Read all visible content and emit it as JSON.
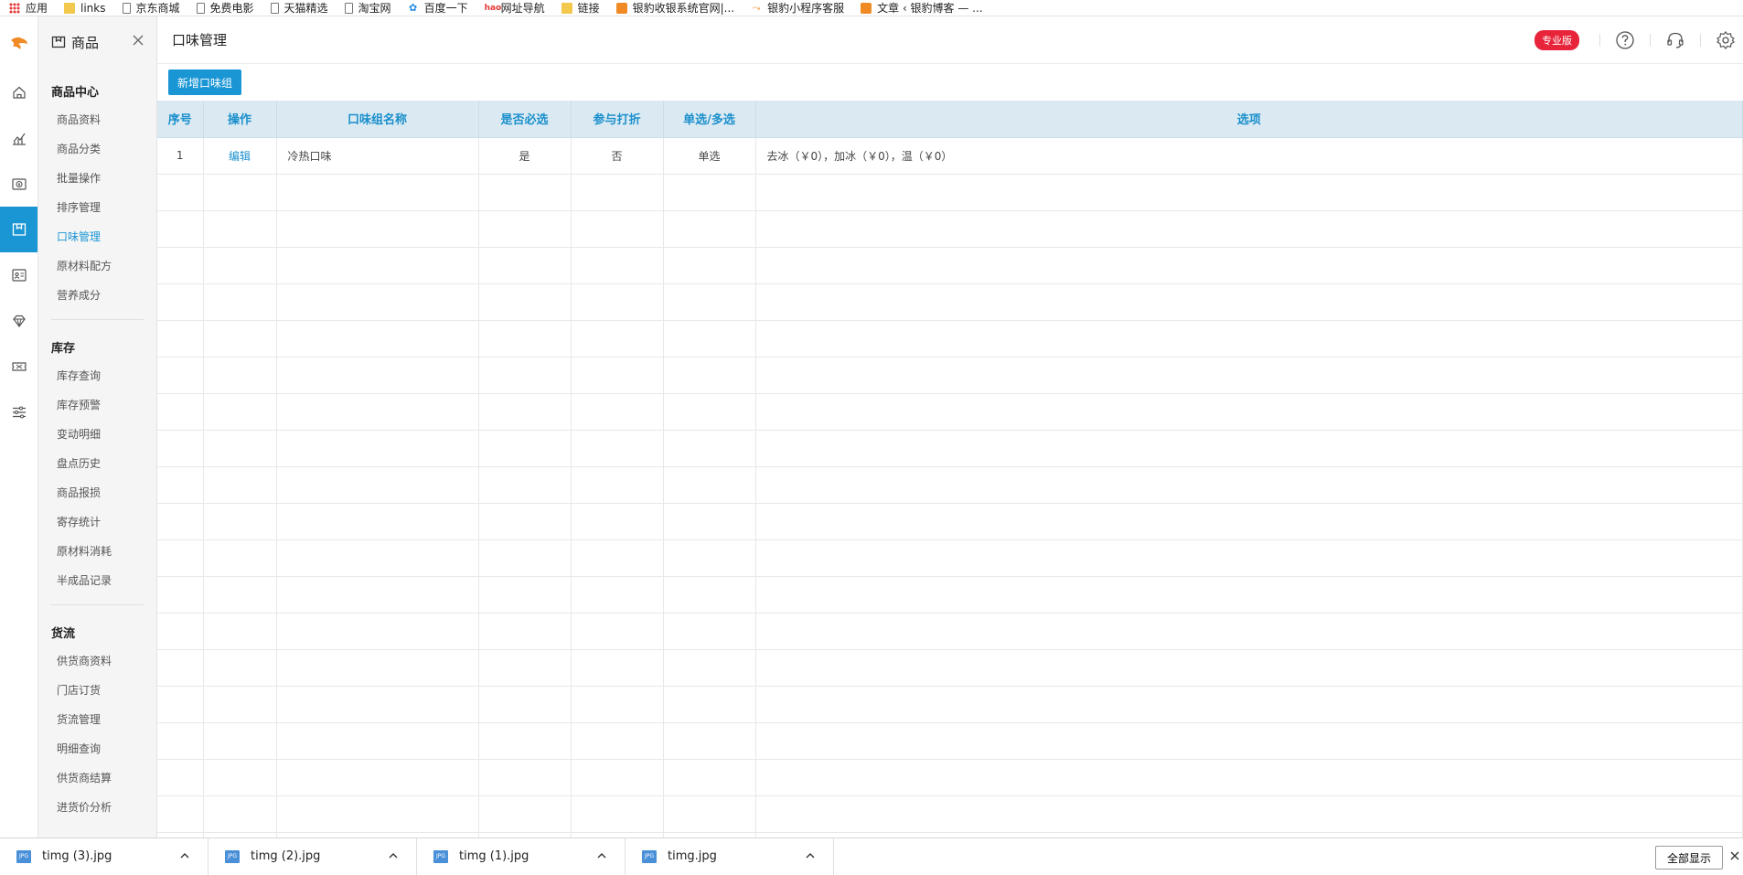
{
  "bookmarks": [
    {
      "label": "应用",
      "icon": "apps-grid-icon"
    },
    {
      "label": "links",
      "icon": "folder-icon"
    },
    {
      "label": "京东商城",
      "icon": "page-icon"
    },
    {
      "label": "免费电影",
      "icon": "page-icon"
    },
    {
      "label": "天猫精选",
      "icon": "page-icon"
    },
    {
      "label": "淘宝网",
      "icon": "page-icon"
    },
    {
      "label": "百度一下",
      "icon": "globe-icon"
    },
    {
      "label": "网址导航",
      "icon": "hao-icon"
    },
    {
      "label": "链接",
      "icon": "folder-icon"
    },
    {
      "label": "银豹收银系统官网|...",
      "icon": "orange-icon"
    },
    {
      "label": "银豹小程序客服",
      "icon": "logo-icon"
    },
    {
      "label": "文章 ‹ 银豹博客 — ...",
      "icon": "orange-icon"
    }
  ],
  "rail": {
    "items": [
      "home-icon",
      "chart-icon",
      "money-icon",
      "goods-icon",
      "member-icon",
      "diamond-icon",
      "coupon-icon",
      "settings-sliders-icon"
    ],
    "active_index": 3
  },
  "sidenav": {
    "title": "商品",
    "groups": [
      {
        "title": "商品中心",
        "items": [
          "商品资料",
          "商品分类",
          "批量操作",
          "排序管理",
          "口味管理",
          "原材料配方",
          "营养成分"
        ]
      },
      {
        "title": "库存",
        "items": [
          "库存查询",
          "库存预警",
          "变动明细",
          "盘点历史",
          "商品报损",
          "寄存统计",
          "原材料消耗",
          "半成品记录"
        ]
      },
      {
        "title": "货流",
        "items": [
          "供货商资料",
          "门店订货",
          "货流管理",
          "明细查询",
          "供货商结算",
          "进货价分析"
        ]
      }
    ],
    "active_item": "口味管理"
  },
  "header": {
    "title": "口味管理",
    "badge": "专业版"
  },
  "toolbar": {
    "add_label": "新增口味组"
  },
  "table": {
    "columns": [
      "序号",
      "操作",
      "口味组名称",
      "是否必选",
      "参与打折",
      "单选/多选",
      "选项"
    ],
    "rows": [
      {
        "index": "1",
        "action": "编辑",
        "name": "冷热口味",
        "required": "是",
        "discount": "否",
        "mode": "单选",
        "options": "去冰（￥0），加冰（￥0），温（￥0）"
      }
    ],
    "empty_rows": 19
  },
  "downloads": {
    "files": [
      "timg (3).jpg",
      "timg (2).jpg",
      "timg (1).jpg",
      "timg.jpg"
    ],
    "show_all": "全部显示"
  }
}
